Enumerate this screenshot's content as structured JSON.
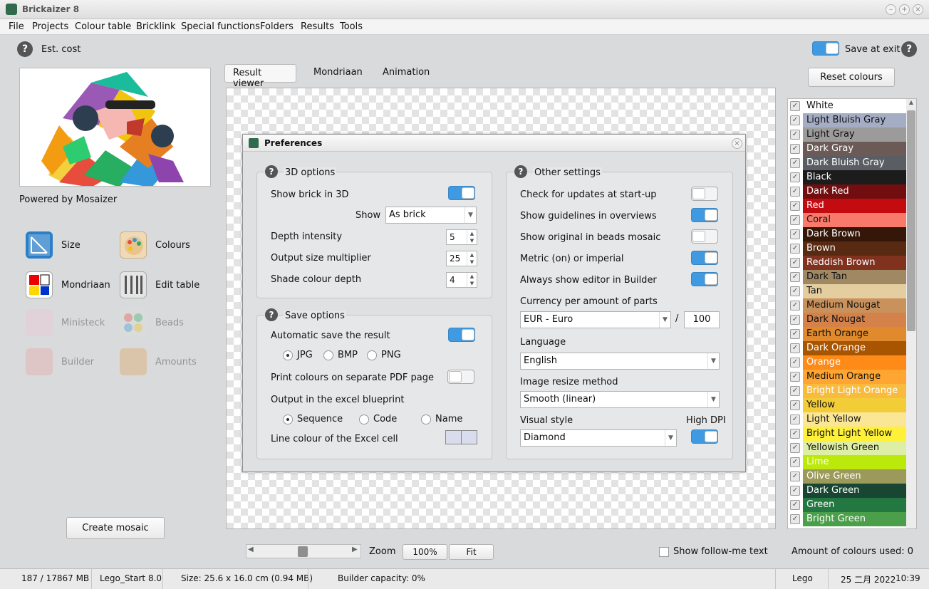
{
  "window": {
    "title": "Brickaizer 8"
  },
  "menu": [
    "File",
    "Projects",
    "Colour table",
    "Bricklink",
    "Special functions",
    "Folders",
    "Results",
    "Tools"
  ],
  "header": {
    "est_cost": "Est. cost",
    "save_at_exit": "Save at exit",
    "save_at_exit_on": true,
    "reset_colours": "Reset colours"
  },
  "left": {
    "powered_by": "Powered by Mosaizer",
    "tools": [
      {
        "label": "Size",
        "enabled": true
      },
      {
        "label": "Colours",
        "enabled": true
      },
      {
        "label": "Mondriaan",
        "enabled": true
      },
      {
        "label": "Edit table",
        "enabled": true
      },
      {
        "label": "Ministeck",
        "enabled": false
      },
      {
        "label": "Beads",
        "enabled": false
      },
      {
        "label": "Builder",
        "enabled": false
      },
      {
        "label": "Amounts",
        "enabled": false
      }
    ],
    "create_mosaic": "Create mosaic"
  },
  "tabs": [
    {
      "label": "Result viewer",
      "active": true
    },
    {
      "label": "Mondriaan",
      "active": false
    },
    {
      "label": "Animation",
      "active": false
    }
  ],
  "preferences": {
    "title": "Preferences",
    "options3d": {
      "title": "3D options",
      "show_brick_3d": "Show brick in 3D",
      "show_brick_3d_on": true,
      "show_label": "Show",
      "show_value": "As brick",
      "depth_intensity": "Depth intensity",
      "depth_value": "5",
      "output_multiplier": "Output size multiplier",
      "output_value": "25",
      "shade_depth": "Shade colour depth",
      "shade_value": "4"
    },
    "save": {
      "title": "Save options",
      "auto_save": "Automatic save  the result",
      "auto_save_on": true,
      "formats": [
        "JPG",
        "BMP",
        "PNG"
      ],
      "format_selected": "JPG",
      "print_colours": "Print colours on separate PDF page",
      "print_colours_on": false,
      "excel_blueprint": "Output in the excel blueprint",
      "blueprint_options": [
        "Sequence",
        "Code",
        "Name"
      ],
      "blueprint_selected": "Sequence",
      "line_colour": "Line colour of the Excel cell"
    },
    "other": {
      "title": "Other settings",
      "toggles": [
        {
          "label": "Check for updates at start-up",
          "on": false
        },
        {
          "label": "Show guidelines in overviews",
          "on": true
        },
        {
          "label": "Show original in beads mosaic",
          "on": false
        },
        {
          "label": "Metric (on) or imperial",
          "on": true
        },
        {
          "label": "Always show editor in Builder",
          "on": true
        }
      ],
      "currency_label": "Currency per amount of parts",
      "currency_value": "EUR - Euro",
      "slash": "/",
      "amount": "100",
      "language_label": "Language",
      "language_value": "English",
      "resize_label": "Image resize method",
      "resize_value": "Smooth (linear)",
      "visual_label": "Visual style",
      "visual_value": "Diamond",
      "high_dpi": "High DPI",
      "high_dpi_on": true
    }
  },
  "colours": [
    {
      "name": "White",
      "bg": "#ffffff",
      "fg": "#111111"
    },
    {
      "name": "Light Bluish Gray",
      "bg": "#a5adc4",
      "fg": "#111111"
    },
    {
      "name": "Light Gray",
      "bg": "#9b9b9b",
      "fg": "#111111"
    },
    {
      "name": "Dark Gray",
      "bg": "#6b5a55",
      "fg": "#ffffff"
    },
    {
      "name": "Dark Bluish Gray",
      "bg": "#5a5d63",
      "fg": "#ffffff"
    },
    {
      "name": "Black",
      "bg": "#1c1c1c",
      "fg": "#ffffff"
    },
    {
      "name": "Dark Red",
      "bg": "#720e0f",
      "fg": "#ffffff"
    },
    {
      "name": "Red",
      "bg": "#c40b10",
      "fg": "#ffffff"
    },
    {
      "name": "Coral",
      "bg": "#f97a6b",
      "fg": "#111111"
    },
    {
      "name": "Dark Brown",
      "bg": "#351709",
      "fg": "#ffffff"
    },
    {
      "name": "Brown",
      "bg": "#582a12",
      "fg": "#ffffff"
    },
    {
      "name": "Reddish Brown",
      "bg": "#81321f",
      "fg": "#ffffff"
    },
    {
      "name": "Dark Tan",
      "bg": "#a08962",
      "fg": "#111111"
    },
    {
      "name": "Tan",
      "bg": "#e4cd9e",
      "fg": "#111111"
    },
    {
      "name": "Medium Nougat",
      "bg": "#c9915c",
      "fg": "#111111"
    },
    {
      "name": "Dark Nougat",
      "bg": "#d4814a",
      "fg": "#111111"
    },
    {
      "name": "Earth Orange",
      "bg": "#e08a2d",
      "fg": "#111111"
    },
    {
      "name": "Dark Orange",
      "bg": "#a95500",
      "fg": "#ffffff"
    },
    {
      "name": "Orange",
      "bg": "#fe8a18",
      "fg": "#ffffff"
    },
    {
      "name": "Medium Orange",
      "bg": "#ffa531",
      "fg": "#111111"
    },
    {
      "name": "Bright Light Orange",
      "bg": "#f8bb3d",
      "fg": "#ffffff"
    },
    {
      "name": "Yellow",
      "bg": "#f2cd37",
      "fg": "#111111"
    },
    {
      "name": "Light Yellow",
      "bg": "#fbe696",
      "fg": "#111111"
    },
    {
      "name": "Bright Light Yellow",
      "bg": "#fff03a",
      "fg": "#111111"
    },
    {
      "name": "Yellowish Green",
      "bg": "#dfeea5",
      "fg": "#111111"
    },
    {
      "name": "Lime",
      "bg": "#bbe90b",
      "fg": "#ffffff"
    },
    {
      "name": "Olive Green",
      "bg": "#9b9a5a",
      "fg": "#ffffff"
    },
    {
      "name": "Dark Green",
      "bg": "#184632",
      "fg": "#ffffff"
    },
    {
      "name": "Green",
      "bg": "#237841",
      "fg": "#ffffff"
    },
    {
      "name": "Bright Green",
      "bg": "#4b9f4a",
      "fg": "#ffffff"
    }
  ],
  "bottom": {
    "zoom": "Zoom",
    "zoom_value": "100%",
    "fit": "Fit",
    "follow_me": "Show follow-me text",
    "amount_colours": "Amount of colours used: 0"
  },
  "status": {
    "memory": "187 / 17867 MB",
    "project": "Lego_Start 8.0",
    "size": "Size: 25.6 x 16.0 cm (0.94 MB)",
    "capacity": "Builder capacity: 0%",
    "brand": "Lego",
    "date": "25 二月 2022",
    "time": "10:39"
  }
}
